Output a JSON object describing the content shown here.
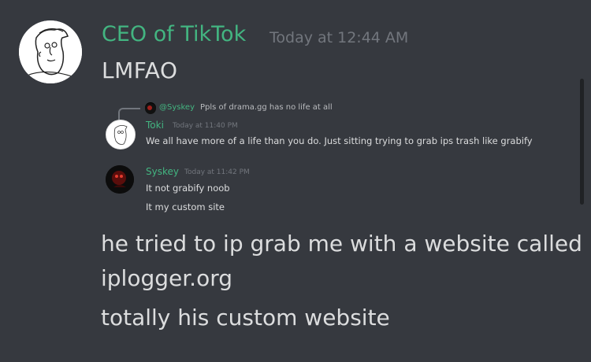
{
  "message": {
    "author": "CEO of TikTok",
    "timestamp": "Today at 12:44 AM",
    "line1": "LMFAO",
    "author_color": "#43b581"
  },
  "embed": {
    "reply": {
      "mention": "@Syskey",
      "text": "Ppls of drama.gg has no life at all"
    },
    "messages": [
      {
        "author": "Toki",
        "timestamp": "Today at 11:40 PM",
        "lines": [
          "We all have more of a life than you do. Just sitting trying to grab ips trash like grabify"
        ],
        "avatar": "sketch-face-avatar"
      },
      {
        "author": "Syskey",
        "timestamp": "Today at 11:42 PM",
        "lines": [
          "It not grabify noob",
          "It my custom site"
        ],
        "avatar": "dark-red-avatar"
      }
    ]
  },
  "body": {
    "line2a": "he tried to ip grab me with a website called",
    "line2b": "iplogger.org",
    "line3": "totally his custom website"
  }
}
